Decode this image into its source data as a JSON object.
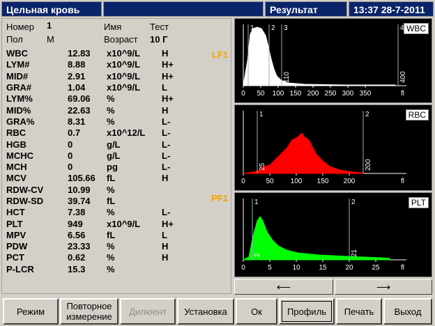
{
  "header": {
    "title": "Цельная кровь",
    "result": "Результат",
    "datetime": "13:37 28-7-2011"
  },
  "patient": {
    "number_label": "Номер",
    "number_value": "1",
    "sex_label": "Пол",
    "sex_value": "М",
    "name_label": "Имя",
    "name_value": "Тест",
    "age_label": "Возраст",
    "age_value": "10 Г"
  },
  "flags": {
    "lf1": "LF1",
    "pf1": "PF1"
  },
  "results": [
    {
      "param": "WBC",
      "value": "12.83",
      "unit": "x10^9/L",
      "flag": "H"
    },
    {
      "param": "LYM#",
      "value": "8.88",
      "unit": "x10^9/L",
      "flag": "H+"
    },
    {
      "param": "MID#",
      "value": "2.91",
      "unit": "x10^9/L",
      "flag": "H+"
    },
    {
      "param": "GRA#",
      "value": "1.04",
      "unit": "x10^9/L",
      "flag": "L"
    },
    {
      "param": "LYM%",
      "value": "69.06",
      "unit": "%",
      "flag": "H+"
    },
    {
      "param": "MID%",
      "value": "22.63",
      "unit": "%",
      "flag": "H"
    },
    {
      "param": "GRA%",
      "value": "8.31",
      "unit": "%",
      "flag": "L-"
    },
    {
      "param": "RBC",
      "value": "0.7",
      "unit": "x10^12/L",
      "flag": "L-"
    },
    {
      "param": "HGB",
      "value": "0",
      "unit": "g/L",
      "flag": "L-"
    },
    {
      "param": "MCHC",
      "value": "0",
      "unit": "g/L",
      "flag": "L-"
    },
    {
      "param": "MCH",
      "value": "0",
      "unit": "pg",
      "flag": "L-"
    },
    {
      "param": "MCV",
      "value": "105.66",
      "unit": "fL",
      "flag": "H"
    },
    {
      "param": "RDW-CV",
      "value": "10.99",
      "unit": "%",
      "flag": ""
    },
    {
      "param": "RDW-SD",
      "value": "39.74",
      "unit": "fL",
      "flag": ""
    },
    {
      "param": "HCT",
      "value": "7.38",
      "unit": "%",
      "flag": "L-"
    },
    {
      "param": "PLT",
      "value": "949",
      "unit": "x10^9/L",
      "flag": "H+"
    },
    {
      "param": "MPV",
      "value": "6.56",
      "unit": "fL",
      "flag": "L"
    },
    {
      "param": "PDW",
      "value": "23.33",
      "unit": "%",
      "flag": "H"
    },
    {
      "param": "PCT",
      "value": "0.62",
      "unit": "%",
      "flag": "H"
    },
    {
      "param": "P-LCR",
      "value": "15.3",
      "unit": "%",
      "flag": ""
    }
  ],
  "histograms": {
    "wbc": {
      "label": "WBC",
      "color": "#ffffff",
      "ticks": [
        "0",
        "50",
        "100",
        "150",
        "200",
        "250",
        "300",
        "350"
      ],
      "unit": "fl",
      "markers": [
        {
          "num": "1",
          "value": "15"
        },
        {
          "num": "2",
          "value": "74"
        },
        {
          "num": "3",
          "value": "110"
        },
        {
          "num": "4",
          "value": "400"
        }
      ]
    },
    "rbc": {
      "label": "RBC",
      "color": "#ff0000",
      "ticks": [
        "0",
        "50",
        "100",
        "150",
        "200"
      ],
      "unit": "fl",
      "markers": [
        {
          "num": "1",
          "value": "25"
        },
        {
          "num": "2",
          "value": "200"
        }
      ]
    },
    "plt": {
      "label": "PLT",
      "color": "#00ff00",
      "ticks": [
        "0",
        "5",
        "10",
        "15",
        "20",
        "25"
      ],
      "unit": "fl",
      "markers": [
        {
          "num": "1",
          "value": "2"
        },
        {
          "num": "2",
          "value": "21"
        }
      ]
    }
  },
  "nav": {
    "prev": "⟵",
    "next": "⟶"
  },
  "toolbar": {
    "mode": "Режим",
    "repeat": "Повторное измерение",
    "diluent": "Дилюент",
    "setup": "Установка",
    "ok": "Ок",
    "profile": "Профиль",
    "print": "Печать",
    "exit": "Выход"
  }
}
